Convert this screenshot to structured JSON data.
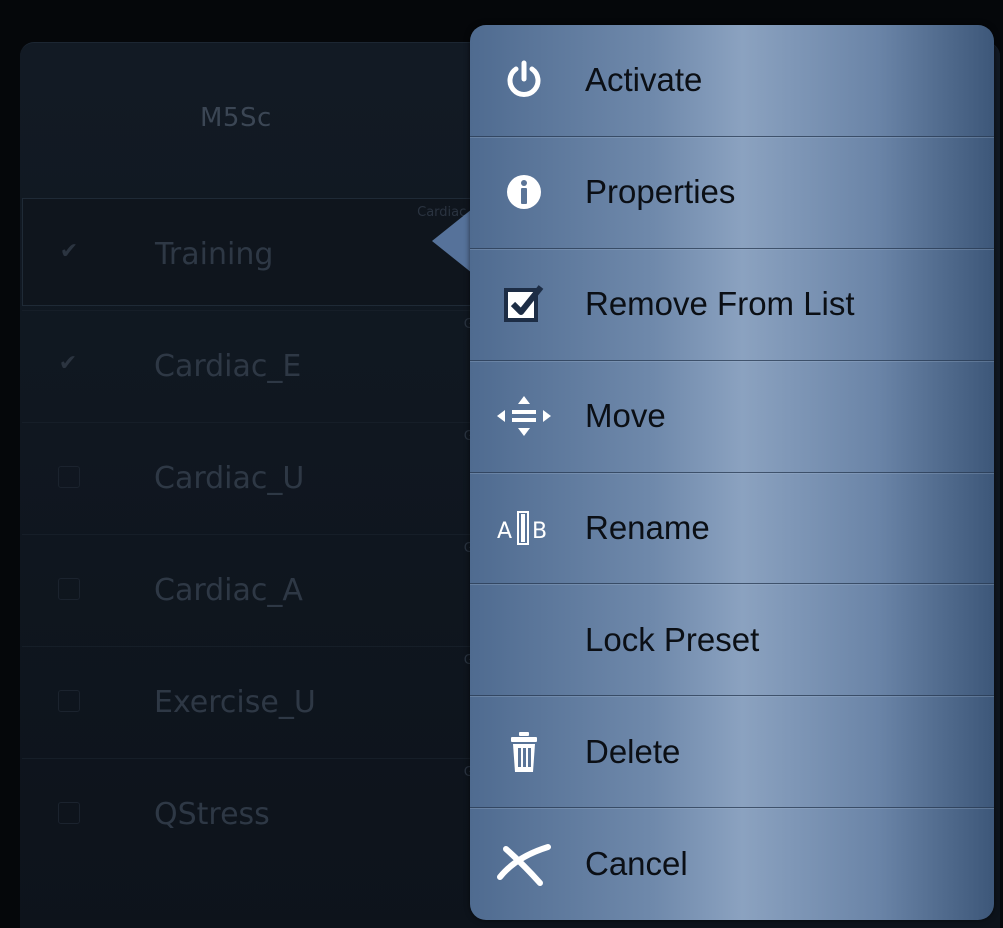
{
  "probe": {
    "name": "M5Sc"
  },
  "presets": [
    {
      "name": "Training",
      "sub": "Cardiac_E",
      "checked": true,
      "selected": true
    },
    {
      "name": "Cardiac_E",
      "sub": "GE",
      "checked": true,
      "selected": false
    },
    {
      "name": "Cardiac_U",
      "sub": "GE",
      "checked": false,
      "selected": false
    },
    {
      "name": "Cardiac_A",
      "sub": "GE",
      "checked": false,
      "selected": false
    },
    {
      "name": "Exercise_U",
      "sub": "GE",
      "checked": false,
      "selected": false
    },
    {
      "name": "QStress",
      "sub": "GE",
      "checked": false,
      "selected": false
    }
  ],
  "menu": {
    "items": [
      {
        "label": "Activate",
        "icon": "power-icon"
      },
      {
        "label": "Properties",
        "icon": "info-icon"
      },
      {
        "label": "Remove From List",
        "icon": "checkbox-icon"
      },
      {
        "label": "Move",
        "icon": "move-arrows-icon"
      },
      {
        "label": "Rename",
        "icon": "rename-icon"
      },
      {
        "label": "Lock Preset",
        "icon": ""
      },
      {
        "label": "Delete",
        "icon": "trash-icon"
      },
      {
        "label": "Cancel",
        "icon": "cancel-icon"
      }
    ]
  },
  "colors": {
    "menu_accent": "#7b95b8",
    "background": "#05070a",
    "menu_text": "#0b0f15"
  }
}
